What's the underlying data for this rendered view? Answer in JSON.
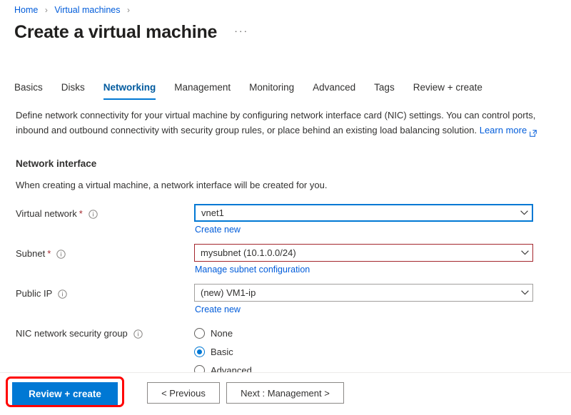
{
  "breadcrumb": {
    "items": [
      {
        "label": "Home"
      },
      {
        "label": "Virtual machines"
      }
    ],
    "separator": "›"
  },
  "header": {
    "title": "Create a virtual machine",
    "more_actions": "···"
  },
  "tabs": [
    {
      "label": "Basics",
      "active": false
    },
    {
      "label": "Disks",
      "active": false
    },
    {
      "label": "Networking",
      "active": true
    },
    {
      "label": "Management",
      "active": false
    },
    {
      "label": "Monitoring",
      "active": false
    },
    {
      "label": "Advanced",
      "active": false
    },
    {
      "label": "Tags",
      "active": false
    },
    {
      "label": "Review + create",
      "active": false
    }
  ],
  "description": {
    "text": "Define network connectivity for your virtual machine by configuring network interface card (NIC) settings. You can control ports, inbound and outbound connectivity with security group rules, or place behind an existing load balancing solution.",
    "learn_more": "Learn more"
  },
  "section": {
    "heading": "Network interface",
    "subtext": "When creating a virtual machine, a network interface will be created for you."
  },
  "fields": {
    "virtual_network": {
      "label": "Virtual network",
      "required": "*",
      "value": "vnet1",
      "sub_link": "Create new"
    },
    "subnet": {
      "label": "Subnet",
      "required": "*",
      "value": "mysubnet (10.1.0.0/24)",
      "sub_link": "Manage subnet configuration"
    },
    "public_ip": {
      "label": "Public IP",
      "value": "(new) VM1-ip",
      "sub_link": "Create new"
    },
    "nic_nsg": {
      "label": "NIC network security group",
      "options": [
        {
          "label": "None",
          "selected": false
        },
        {
          "label": "Basic",
          "selected": true
        },
        {
          "label": "Advanced",
          "selected": false
        }
      ]
    }
  },
  "footer": {
    "review_create": "Review + create",
    "previous": "< Previous",
    "next": "Next : Management >"
  },
  "colors": {
    "accent": "#0078d4",
    "link": "#015cda",
    "error": "#a4262c",
    "highlight": "#ff0000"
  }
}
